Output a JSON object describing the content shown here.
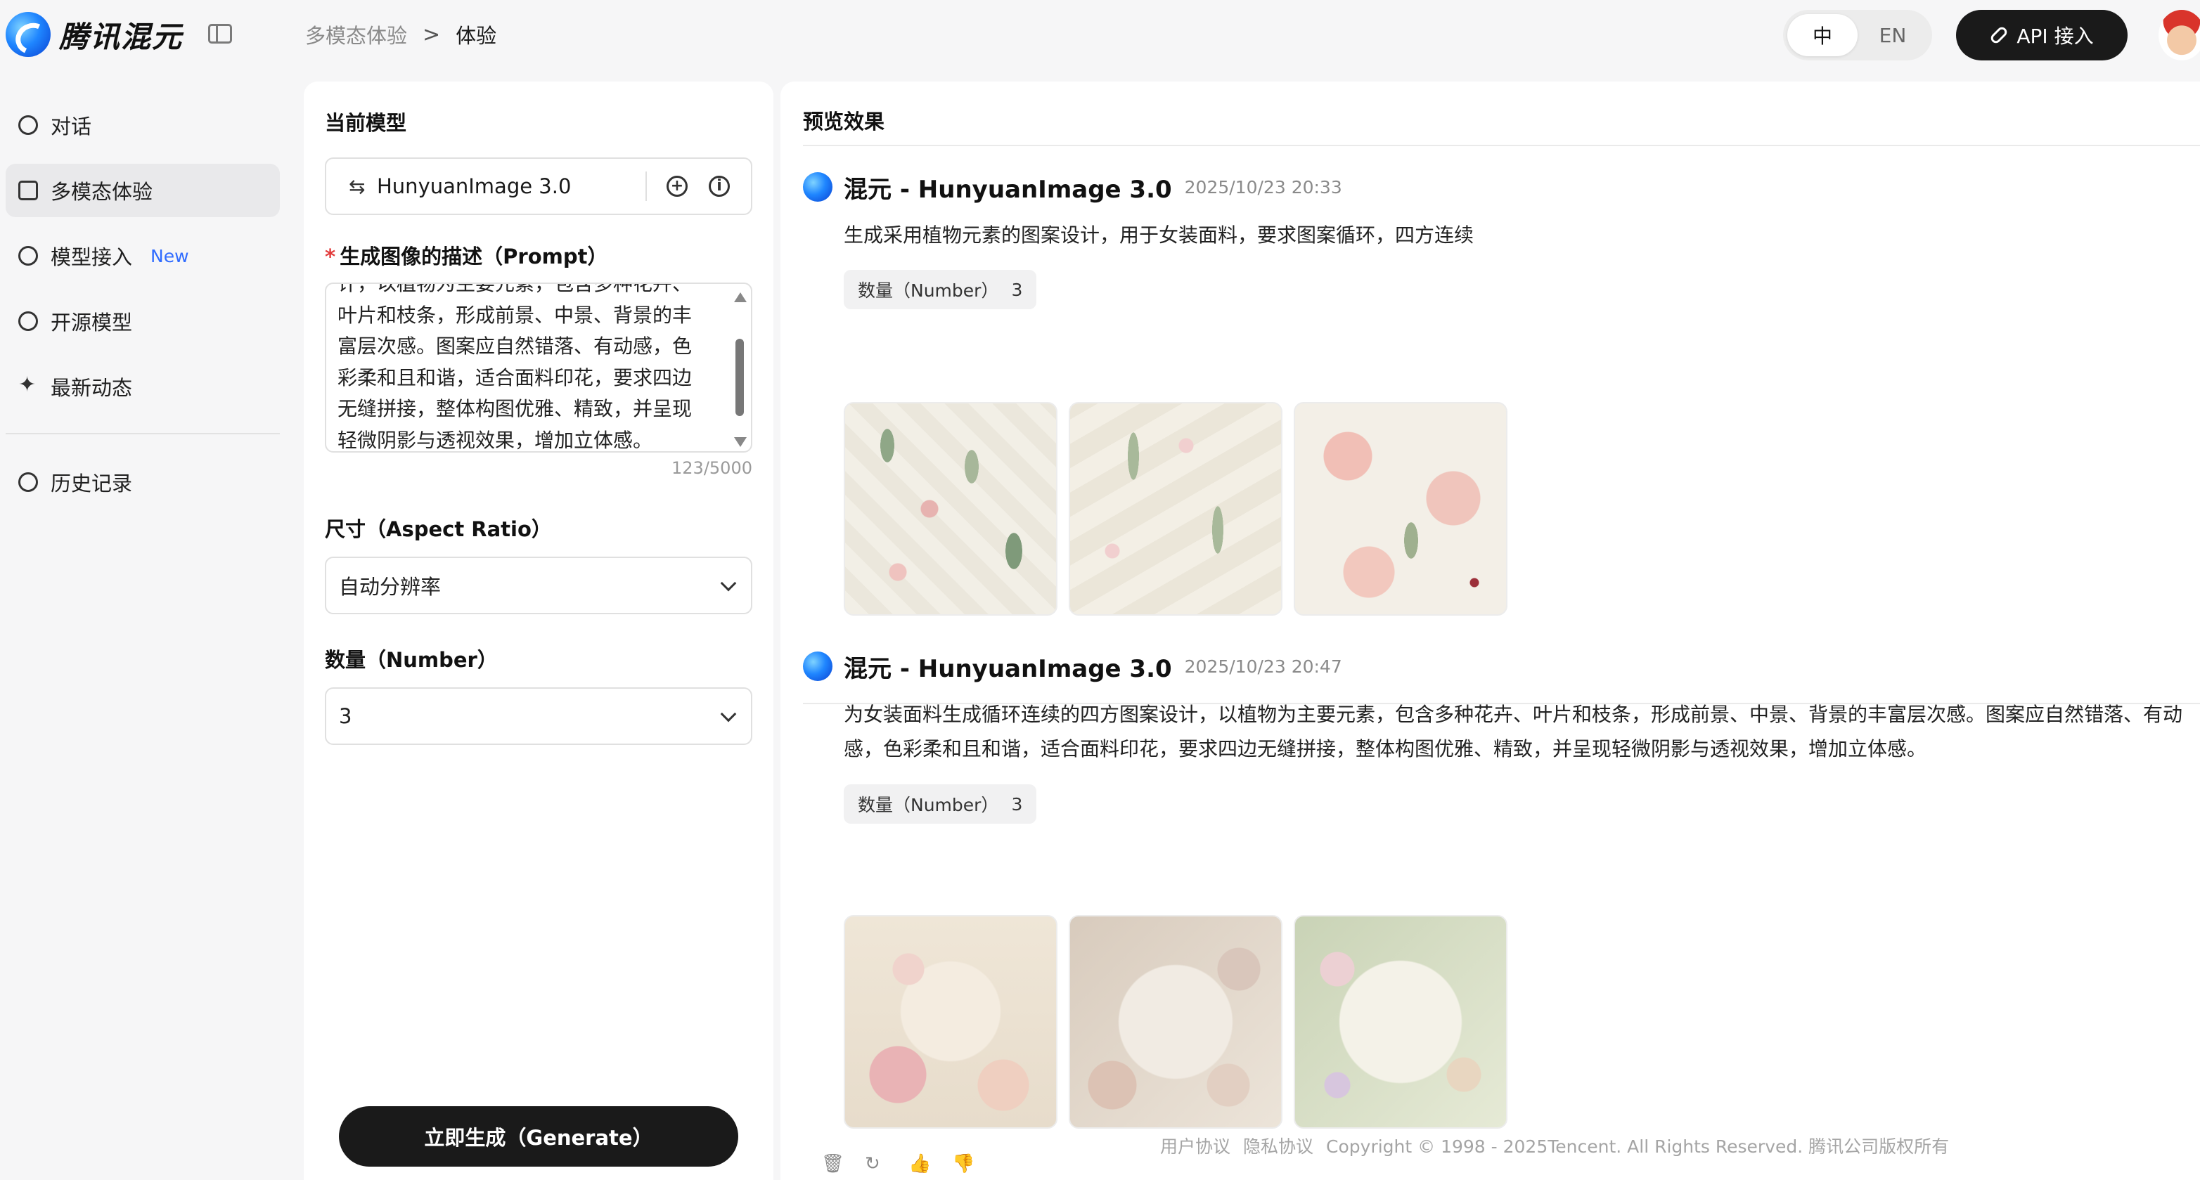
{
  "header": {
    "logo_text": "腾讯混元",
    "breadcrumb_parent": "多模态体验",
    "breadcrumb_sep": ">",
    "breadcrumb_current": "体验",
    "lang_zh": "中",
    "lang_en": "EN",
    "api_label": "API 接入"
  },
  "nav": {
    "items": [
      {
        "label": "对话",
        "icon": "chat-icon"
      },
      {
        "label": "多模态体验",
        "icon": "image-icon",
        "active": true
      },
      {
        "label": "模型接入",
        "badge": "New",
        "icon": "model-link-icon"
      },
      {
        "label": "开源模型",
        "icon": "open-source-icon"
      },
      {
        "label": "最新动态",
        "icon": "sparkle-icon"
      }
    ],
    "history": "历史记录"
  },
  "config": {
    "model_title": "当前模型",
    "model_name": "HunyuanImage 3.0",
    "prompt_title": "生成图像的描述（Prompt）",
    "prompt_value": "计，以植物为主要元素，包含多种花卉、叶片和枝条，形成前景、中景、背景的丰富层次感。图案应自然错落、有动感，色彩柔和且和谐，适合面料印花，要求四边无缝拼接，整体构图优雅、精致，并呈现轻微阴影与透视效果，增加立体感。",
    "prompt_counter": "123/5000",
    "size_title": "尺寸（Aspect Ratio）",
    "size_value": "自动分辨率",
    "number_title": "数量（Number）",
    "number_value": "3",
    "generate_label": "立即生成（Generate）"
  },
  "preview": {
    "title": "预览效果",
    "results": [
      {
        "title": "混元 - HunyuanImage 3.0",
        "time": "2025/10/23 20:33",
        "prompt": "生成采用植物元素的图案设计，用于女装面料，要求图案循环，四方连续",
        "tag_label": "数量（Number）",
        "tag_value": "3"
      },
      {
        "title": "混元 - HunyuanImage 3.0",
        "time": "2025/10/23 20:47",
        "prompt": "为女装面料生成循环连续的四方图案设计，以植物为主要元素，包含多种花卉、叶片和枝条，形成前景、中景、背景的丰富层次感。图案应自然错落、有动感，色彩柔和且和谐，适合面料印花，要求四边无缝拼接，整体构图优雅、精致，并呈现轻微阴影与透视效果，增加立体感。",
        "tag_label": "数量（Number）",
        "tag_value": "3"
      }
    ]
  },
  "footer": {
    "user_agreement": "用户协议",
    "privacy": "隐私协议",
    "copyright": "Copyright © 1998 - 2025Tencent. All Rights Reserved. 腾讯公司版权所有"
  },
  "colors": {
    "accent_new": "#2f6bff",
    "primary_button": "#1a1a1a",
    "required": "#e23b3b"
  }
}
